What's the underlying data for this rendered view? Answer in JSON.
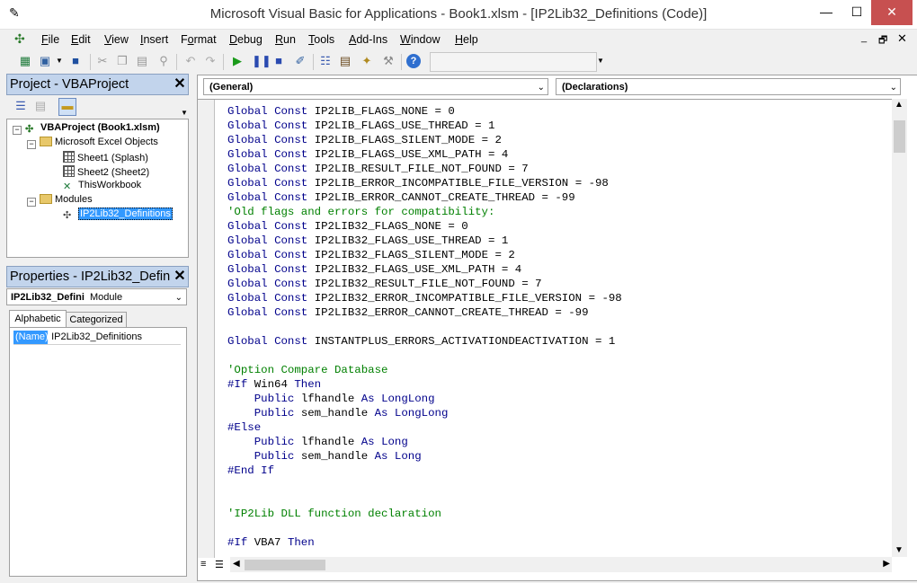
{
  "window": {
    "title": "Microsoft Visual Basic for Applications - Book1.xlsm - [IP2Lib32_Definitions (Code)]"
  },
  "menu": {
    "items": [
      {
        "label": "File",
        "hotkey": "F"
      },
      {
        "label": "Edit",
        "hotkey": "E"
      },
      {
        "label": "View",
        "hotkey": "V"
      },
      {
        "label": "Insert",
        "hotkey": "I"
      },
      {
        "label": "Format",
        "hotkey": "o"
      },
      {
        "label": "Debug",
        "hotkey": "D"
      },
      {
        "label": "Run",
        "hotkey": "R"
      },
      {
        "label": "Tools",
        "hotkey": "T"
      },
      {
        "label": "Add-Ins",
        "hotkey": "A"
      },
      {
        "label": "Window",
        "hotkey": "W"
      },
      {
        "label": "Help",
        "hotkey": "H"
      }
    ]
  },
  "project_pane": {
    "title": "Project - VBAProject",
    "tree": [
      {
        "label": "VBAProject (Book1.xlsm)",
        "icon": "vba-project-icon"
      },
      {
        "label": "Microsoft Excel Objects",
        "icon": "folder-icon"
      },
      {
        "label": "Sheet1 (Splash)",
        "icon": "sheet-icon"
      },
      {
        "label": "Sheet2 (Sheet2)",
        "icon": "sheet-icon"
      },
      {
        "label": "ThisWorkbook",
        "icon": "workbook-icon"
      },
      {
        "label": "Modules",
        "icon": "folder-icon"
      },
      {
        "label": "IP2Lib32_Definitions",
        "icon": "module-icon",
        "selected": true
      }
    ]
  },
  "properties_pane": {
    "title": "Properties - IP2Lib32_Defin",
    "object_name": "IP2Lib32_Defini",
    "object_type": "Module",
    "tabs": [
      "Alphabetic",
      "Categorized"
    ],
    "active_tab": "Alphabetic",
    "rows": [
      {
        "name": "(Name)",
        "value": "IP2Lib32_Definitions"
      }
    ]
  },
  "code_window": {
    "object_combo": "(General)",
    "procedure_combo": "(Declarations)",
    "lines": [
      "Global Const IP2LIB_FLAGS_NONE = 0",
      "Global Const IP2LIB_FLAGS_USE_THREAD = 1",
      "Global Const IP2LIB_FLAGS_SILENT_MODE = 2",
      "Global Const IP2LIB_FLAGS_USE_XML_PATH = 4",
      "Global Const IP2LIB_RESULT_FILE_NOT_FOUND = 7",
      "Global Const IP2LIB_ERROR_INCOMPATIBLE_FILE_VERSION = -98",
      "Global Const IP2LIB_ERROR_CANNOT_CREATE_THREAD = -99",
      "'Old flags and errors for compatibility:",
      "Global Const IP2LIB32_FLAGS_NONE = 0",
      "Global Const IP2LIB32_FLAGS_USE_THREAD = 1",
      "Global Const IP2LIB32_FLAGS_SILENT_MODE = 2",
      "Global Const IP2LIB32_FLAGS_USE_XML_PATH = 4",
      "Global Const IP2LIB32_RESULT_FILE_NOT_FOUND = 7",
      "Global Const IP2LIB32_ERROR_INCOMPATIBLE_FILE_VERSION = -98",
      "Global Const IP2LIB32_ERROR_CANNOT_CREATE_THREAD = -99",
      "",
      "Global Const INSTANTPLUS_ERRORS_ACTIVATIONDEACTIVATION = 1",
      "",
      "'Option Compare Database",
      "#If Win64 Then",
      "    Public lfhandle As LongLong",
      "    Public sem_handle As LongLong",
      "#Else",
      "    Public lfhandle As Long",
      "    Public sem_handle As Long",
      "#End If",
      "",
      "",
      "'IP2Lib DLL function declaration",
      "",
      "#If VBA7 Then"
    ]
  },
  "colors": {
    "keyword": "#00008b",
    "comment": "#008000",
    "selection": "#3399ff",
    "pane_title_bg": "#c2d4ec",
    "close_button": "#c75050"
  }
}
